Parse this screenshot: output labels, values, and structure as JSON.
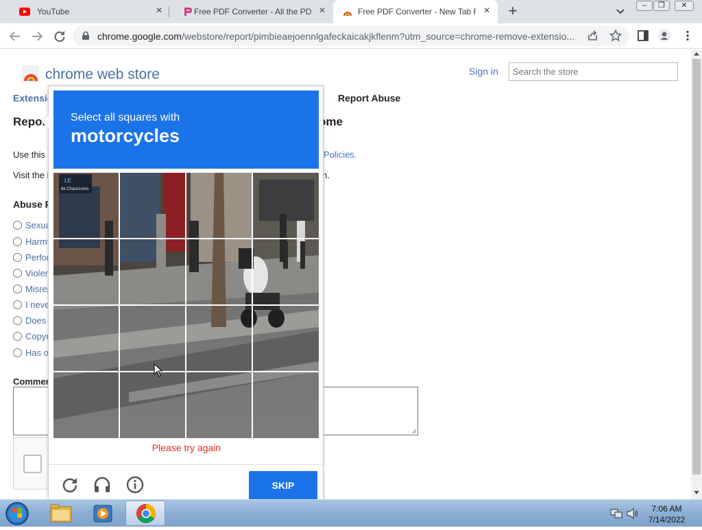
{
  "browser": {
    "tabs": [
      {
        "title": "YouTube",
        "favicon": "youtube-icon",
        "active": false
      },
      {
        "title": "Free PDF Converter - All the PDF",
        "favicon": "pdf-converter-icon",
        "active": false
      },
      {
        "title": "Free PDF Converter - New Tab Fo",
        "favicon": "webstore-icon",
        "active": true
      }
    ],
    "url_host": "chrome.google.com",
    "url_path": "/webstore/report/pimbieaejoennlgafeckaicakjkflenm?utm_source=chrome-remove-extensio..."
  },
  "store": {
    "title": "chrome web store",
    "signin": "Sign in",
    "search_placeholder": "Search the store"
  },
  "page": {
    "crumb_extensions": "Extensio",
    "crumb_report": "Report Abuse",
    "heading_left": "Report",
    "heading_right": "ome",
    "use_this": "Use this",
    "policies_link": "Policies.",
    "visit_the": "Visit the i",
    "visit_right": "n.",
    "abuse_heading": "Abuse R",
    "radio_options": [
      "Sexua",
      "Harmf",
      "Perfor",
      "Violen",
      "Misrep",
      "I neve",
      "Does",
      "Copyr",
      "Has o"
    ],
    "comments_heading": "Commen"
  },
  "captcha": {
    "instruction": "Select all squares with",
    "target": "motorcycles",
    "error": "Please try again",
    "skip_label": "SKIP",
    "tile_text_1": "LE",
    "tile_text_2": "de Chaussures"
  },
  "taskbar": {
    "time": "7:06 AM",
    "date": "7/14/2022"
  },
  "colors": {
    "captcha_blue": "#1a73e8",
    "error_red": "#d93025",
    "link_blue": "#4273c8"
  }
}
